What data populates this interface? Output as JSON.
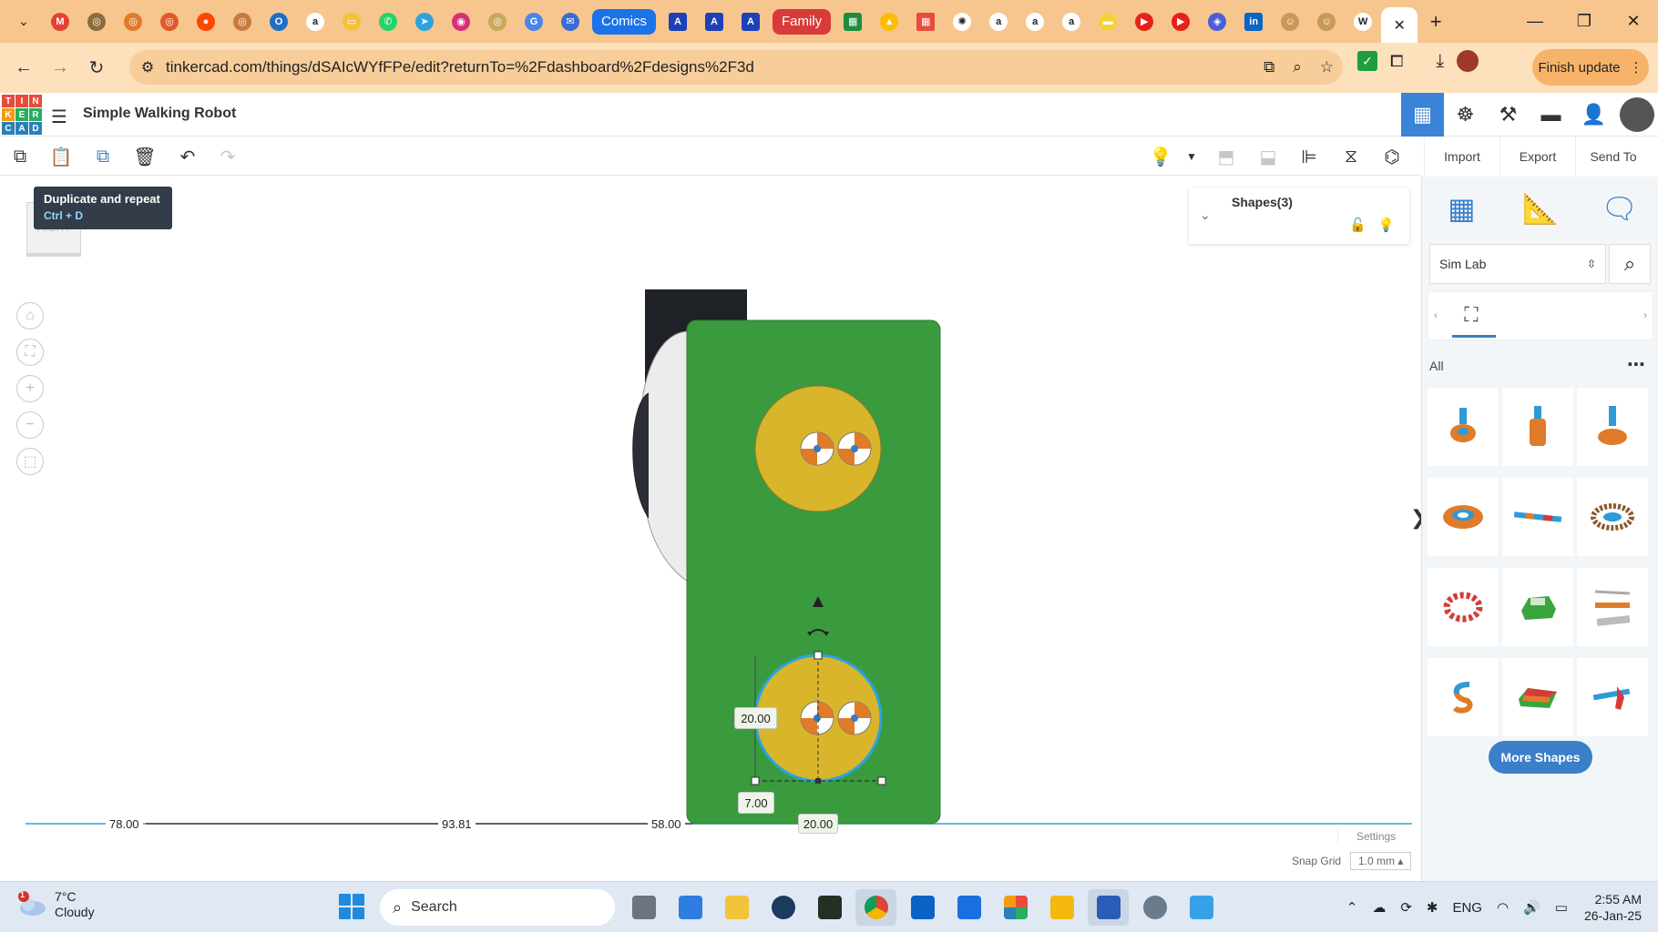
{
  "browser": {
    "tab_labels": [
      "Comics",
      "Family"
    ],
    "url": "tinkercad.com/things/dSAIcWYfFPe/edit?returnTo=%2Fdashboard%2Fdesigns%2F3d",
    "finish_update_label": "Finish update"
  },
  "app": {
    "logo_letters": [
      "T",
      "I",
      "N",
      "K",
      "E",
      "R",
      "C",
      "A",
      "D"
    ],
    "design_title": "Simple Walking Robot"
  },
  "toolbar": {
    "import_label": "Import",
    "export_label": "Export",
    "send_to_label": "Send To"
  },
  "tooltip": {
    "title": "Duplicate and repeat",
    "shortcut": "Ctrl + D"
  },
  "viewcube": {
    "face_label": "RIGHT"
  },
  "shapes_panel": {
    "title": "Shapes(3)"
  },
  "dimensions": {
    "ruler_left": "78.00",
    "ruler_mid": "93.81",
    "ruler_right": "58.00",
    "width_bottom": "20.00",
    "height_side": "20.00",
    "offset": "7.00"
  },
  "workplane": {
    "settings_label": "Settings",
    "snap_grid_label": "Snap Grid",
    "snap_grid_value": "1.0 mm"
  },
  "library": {
    "selected": "Sim Lab",
    "category_label": "All",
    "more_shapes_label": "More Shapes"
  },
  "taskbar": {
    "weather_temp": "7°C",
    "weather_desc": "Cloudy",
    "weather_badge": "1",
    "search_placeholder": "Search",
    "lang": "ENG",
    "time": "2:55 AM",
    "date": "26-Jan-25"
  },
  "colors": {
    "robot_body": "#3a9a3e",
    "wheel_yellow": "#d8b52a",
    "accent_blue": "#3a7fc7",
    "browser_tabbar": "#f6c68e"
  }
}
